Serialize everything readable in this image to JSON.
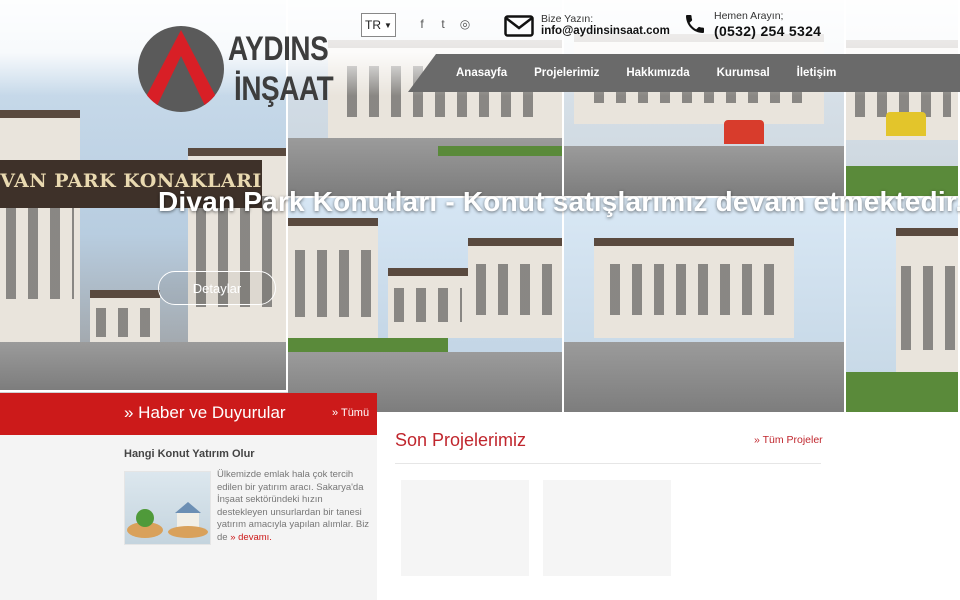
{
  "brand": {
    "name_line1": "AYDINS",
    "name_line2": "İNŞAAT",
    "colors": {
      "red": "#cc1a1a",
      "dark": "#3d3d3d",
      "nav": "#6a6a6a"
    }
  },
  "language": {
    "selected": "TR"
  },
  "social": [
    {
      "icon": "facebook-icon",
      "glyph": "f"
    },
    {
      "icon": "twitter-icon",
      "glyph": "t"
    },
    {
      "icon": "instagram-icon",
      "glyph": "◎"
    }
  ],
  "contact": {
    "email_label": "Bize Yazın:",
    "email": "info@aydinsinsaat.com",
    "phone_label": "Hemen Arayın;",
    "phone": "(0532) 254 5324"
  },
  "nav": {
    "items": [
      "Anasayfa",
      "Projelerimiz",
      "Hakkımızda",
      "Kurumsal",
      "İletişim"
    ]
  },
  "slider": {
    "title": "Divan Park Konutları - Konut satışlarımız devam etmektedir.",
    "button": "Detaylar",
    "sign_text": "VAN PARK KONAKLARI"
  },
  "news": {
    "heading": "» Haber ve Duyurular",
    "all_link": "» Tümü",
    "item_title": "Hangi Konut Yatırım Olur",
    "item_text": "Ülkemizde emlak hala çok tercih edilen bir yatırım aracı. Sakarya'da İnşaat sektöründeki hızın destekleyen unsurlardan bir tanesi yatırım amacıyla yapılan alımlar. Biz de",
    "more_link": "» devamı."
  },
  "projects": {
    "heading": "Son Projelerimiz",
    "all_link": "» Tüm Projeler"
  }
}
